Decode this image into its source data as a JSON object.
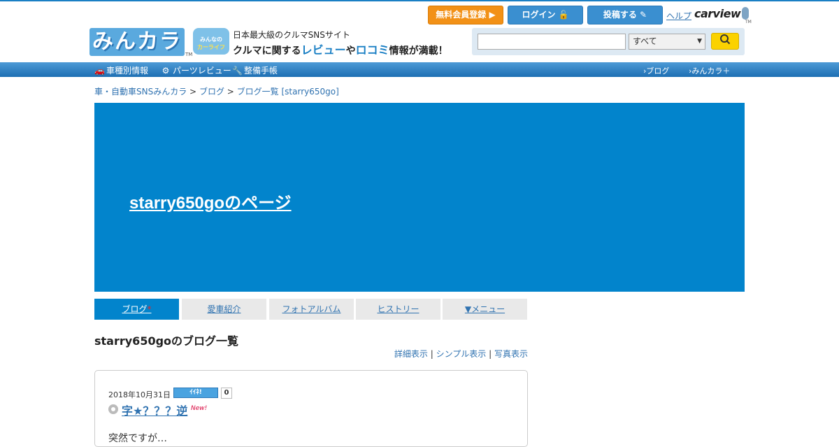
{
  "header": {
    "logo_text": "みんカラ",
    "logo_tm": "TM",
    "carlife_line1": "みんなの",
    "carlife_line2": "カーライフ",
    "tagline1": "日本最大級のクルマSNSサイト",
    "tagline2_pre": "クルマに関する",
    "tagline2_review": "レビュー",
    "tagline2_mid": "や",
    "tagline2_kuchikomi": "ロコミ",
    "tagline2_post": "情報が満載！",
    "register_label": "無料会員登録 ▶",
    "login_label": "ログイン 🔓",
    "post_label": "投稿する ✎",
    "help_label": "ヘルプ",
    "carview_label": "carview",
    "carview_tm": "TM"
  },
  "search": {
    "placeholder": "",
    "scope_selected": "すべて",
    "scope_arrow": "▼",
    "button_icon": "magnifier-icon"
  },
  "nav": {
    "items": [
      {
        "label": "車種別情報",
        "icon": "car-icon"
      },
      {
        "label": "パーツレビュー",
        "icon": "parts-icon"
      },
      {
        "label": "整備手帳",
        "icon": "wrench-icon"
      }
    ],
    "right_items": [
      {
        "label": "ブログ"
      },
      {
        "label": "みんカラ＋"
      }
    ]
  },
  "breadcrumb": {
    "items": [
      "車・自動車SNSみんカラ",
      "ブログ",
      "ブログ一覧 [starry650go]"
    ],
    "separator": ">"
  },
  "banner": {
    "title": "starry650goのページ",
    "bg_color": "#0284cc"
  },
  "tabs": [
    {
      "label": "ブログ",
      "active": true,
      "marker": "*"
    },
    {
      "label": "愛車紹介",
      "active": false
    },
    {
      "label": "フォトアルバム",
      "active": false
    },
    {
      "label": "ヒストリー",
      "active": false
    },
    {
      "label": "▼メニュー",
      "active": false
    }
  ],
  "blog_list": {
    "title": "starry650goのブログ一覧",
    "view_options": [
      "詳細表示",
      "シンプル表示",
      "写真表示"
    ],
    "separator": "|"
  },
  "entry": {
    "date": "2018年10月31日",
    "iine_label": "ｲｲﾈ!",
    "iine_count": "0",
    "title": "字★？？？逆",
    "new_label": "New!",
    "body": "突然ですが…"
  }
}
